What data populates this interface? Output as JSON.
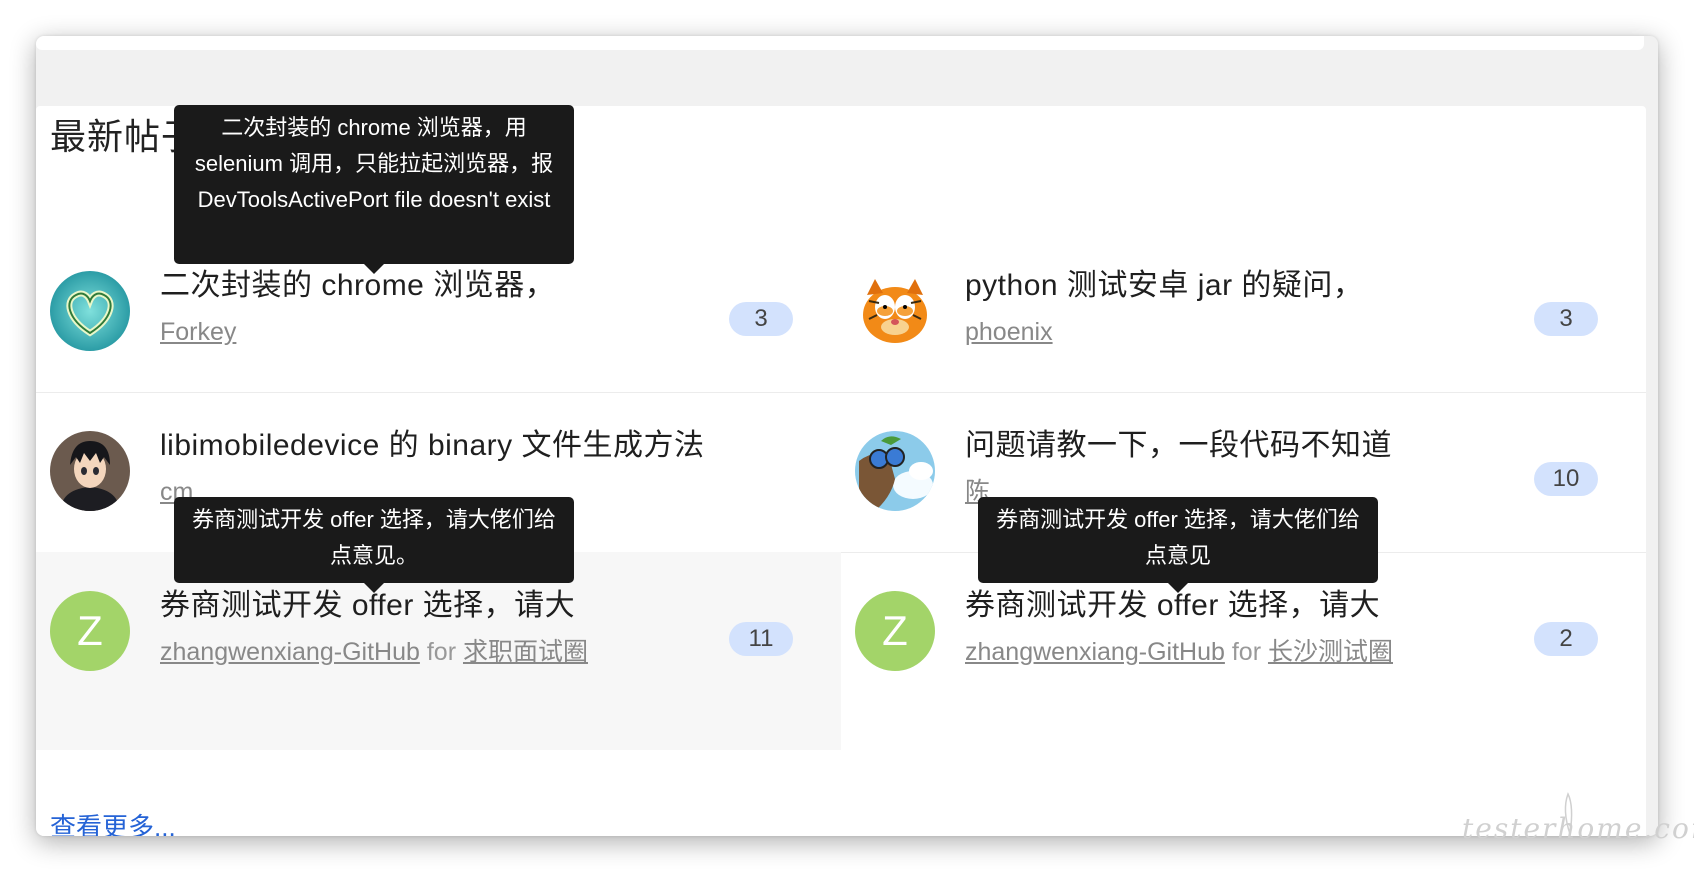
{
  "section_title": "最新帖子",
  "topics": [
    {
      "title": "二次封装的 chrome 浏览器，",
      "author": "Forkey",
      "node": "",
      "replies": "3",
      "avatar": "heart-island-avatar"
    },
    {
      "title": "python 测试安卓 jar 的疑问，",
      "author": "phoenix",
      "node": "",
      "replies": "3",
      "avatar": "garfield-avatar"
    },
    {
      "title": "libimobiledevice 的 binary 文件生成方法",
      "author": "cm",
      "node": "",
      "replies": "",
      "avatar": "anime-boy-avatar"
    },
    {
      "title": "问题请教一下，一段代码不知道",
      "author": "陈",
      "node": "",
      "replies": "10",
      "avatar": "cartoon-diver-avatar"
    },
    {
      "title": "券商测试开发 offer 选择，请大",
      "author": "zhangwenxiang-GitHub",
      "for": "for",
      "node": "求职面试圈",
      "replies": "11",
      "avatar_letter": "Z"
    },
    {
      "title": "券商测试开发 offer 选择，请大",
      "author": "zhangwenxiang-GitHub",
      "for": "for",
      "node": "长沙测试圈",
      "replies": "2",
      "avatar_letter": "Z"
    }
  ],
  "tooltips": {
    "t1": "二次封装的 chrome 浏览器，用 selenium 调用，只能拉起浏览器，报 DevToolsActivePort file doesn't exist",
    "t2": "券商测试开发 offer 选择，请大佬们给点意见。",
    "t3": "券商测试开发 offer 选择，请大佬们给点意见"
  },
  "more_link": "查看更多...",
  "watermark": "testerhome.com",
  "colors": {
    "accent": "#2563d6",
    "badge_bg": "#d3e2fd",
    "letter_avatar": "#a3d469",
    "tooltip_bg": "#1a1a1a"
  }
}
